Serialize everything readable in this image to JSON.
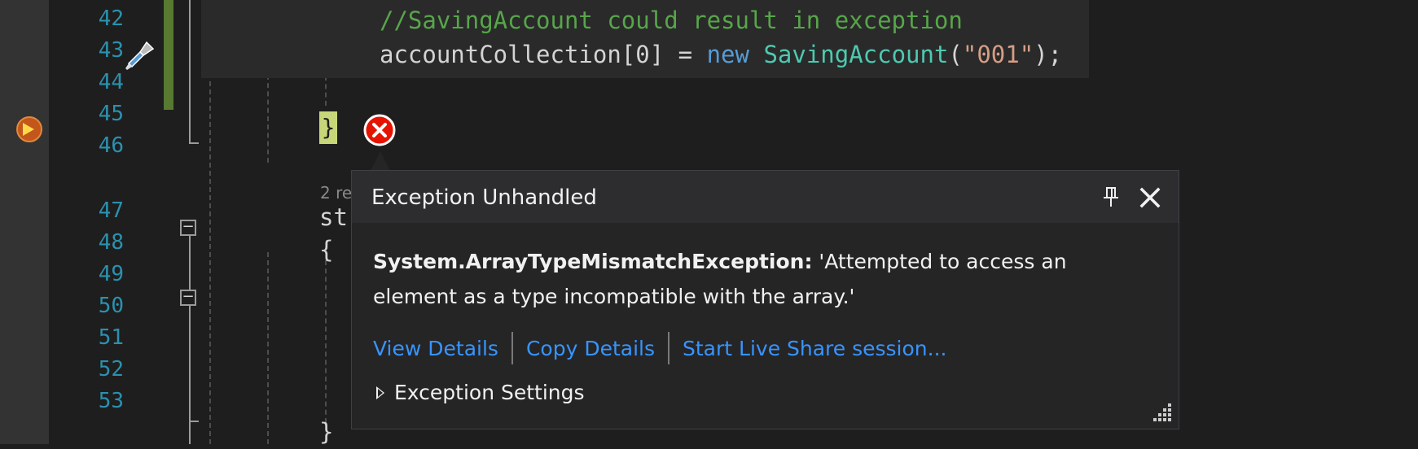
{
  "editor": {
    "line_numbers": [
      "42",
      "43",
      "44",
      "45",
      "46",
      "47",
      "48",
      "49",
      "50",
      "51",
      "52",
      "53"
    ],
    "code": {
      "comment": "//SavingAccount could result in exception",
      "assign_target": "accountCollection[0] = ",
      "keyword_new": "new",
      "type_name": "SavingAccount",
      "open_paren": "(",
      "string_arg": "\"001\"",
      "close": ");",
      "closing_brace": "}",
      "frag_st": "st",
      "frag_open_brace": "{",
      "frag_close_brace": "}"
    },
    "references_fragment": "2 re"
  },
  "exception_popup": {
    "title": "Exception Unhandled",
    "exception_type": "System.ArrayTypeMismatchException:",
    "message": " 'Attempted to access an element as a type incompatible with the array.'",
    "links": {
      "view_details": "View Details",
      "copy_details": "Copy Details",
      "live_share": "Start Live Share session..."
    },
    "settings_label": "Exception Settings"
  },
  "colors": {
    "background": "#1e1e1e",
    "line_number": "#2b91af",
    "comment": "#57a64a",
    "keyword": "#569cd6",
    "type": "#4ec9b0",
    "string": "#d69d85",
    "link": "#3794ff",
    "error": "#e51400"
  }
}
